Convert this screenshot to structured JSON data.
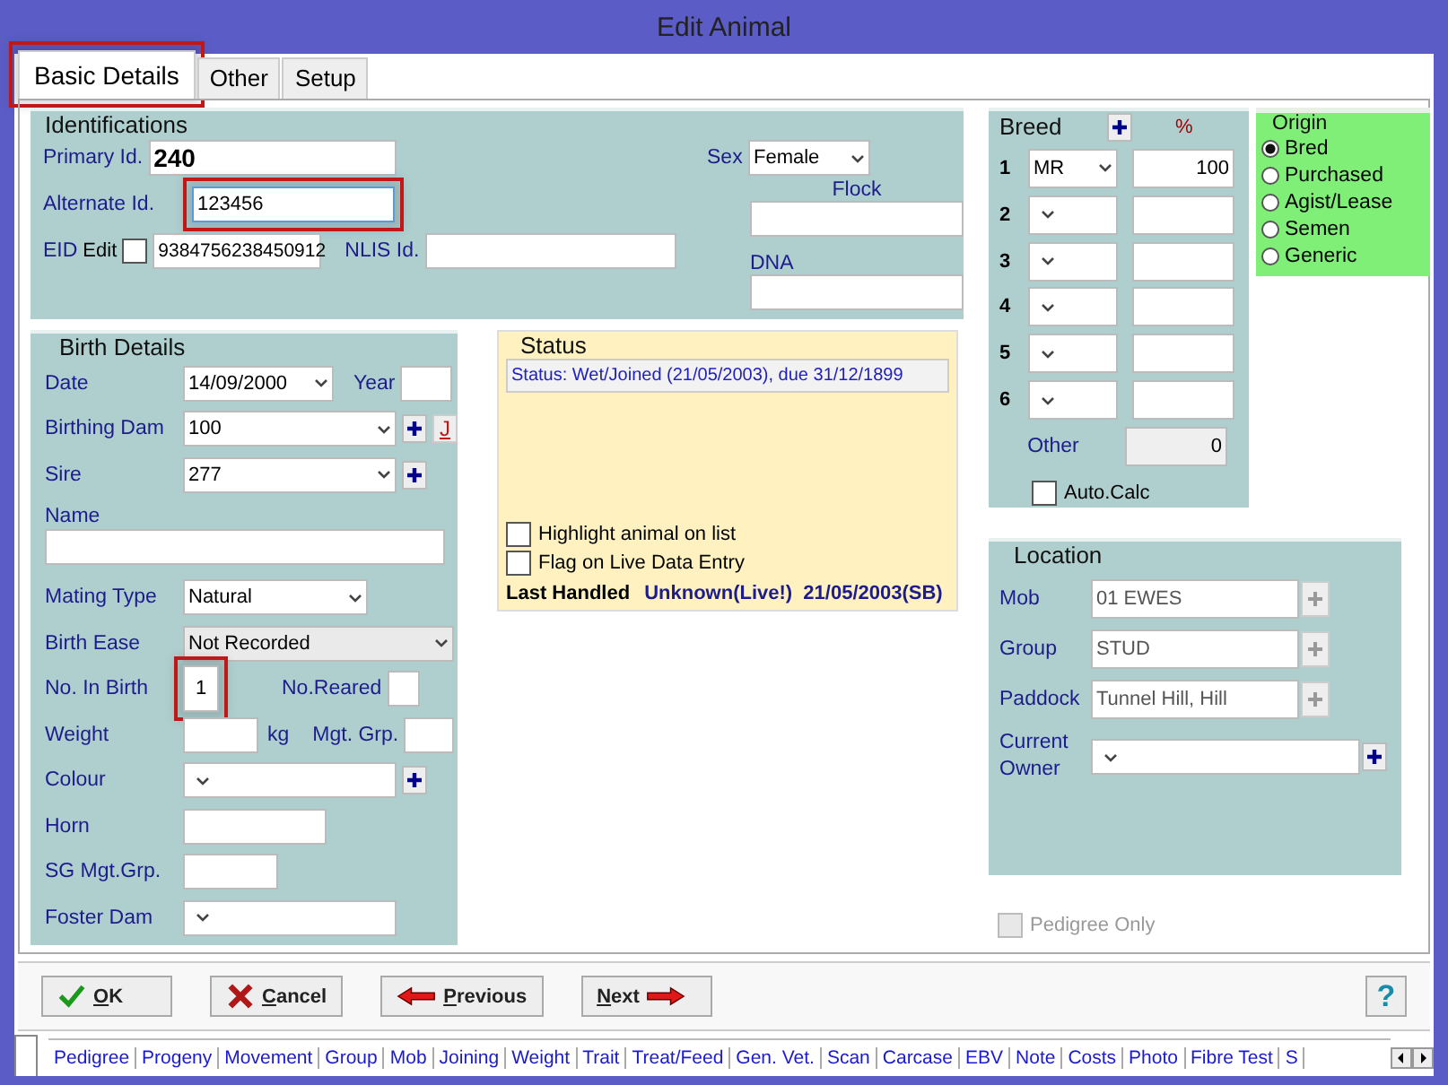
{
  "window": {
    "title": "Edit Animal"
  },
  "tabs": [
    {
      "label": "Basic Details",
      "selected": true,
      "highlighted": true
    },
    {
      "label": "Other",
      "selected": false,
      "highlighted": false
    },
    {
      "label": "Setup",
      "selected": false,
      "highlighted": false
    }
  ],
  "identifications": {
    "title": "Identifications",
    "primary_id": {
      "label": "Primary Id.",
      "value": "240"
    },
    "alternate_id": {
      "label": "Alternate Id.",
      "value": "123456",
      "highlighted": true
    },
    "eid": {
      "label": "EID",
      "edit_label": "Edit",
      "edit_checked": false,
      "value": "9384756238450912"
    },
    "nlis": {
      "label": "NLIS Id."
    },
    "sex": {
      "label": "Sex",
      "value": "Female"
    },
    "flock": {
      "label": "Flock"
    },
    "dna": {
      "label": "DNA"
    }
  },
  "birth_details": {
    "title": "Birth Details",
    "date": {
      "label": "Date",
      "value": "14/09/2000"
    },
    "year": {
      "label": "Year"
    },
    "birthing_dam": {
      "label": "Birthing Dam",
      "value": "100",
      "link": "J"
    },
    "sire": {
      "label": "Sire",
      "value": "277"
    },
    "name": {
      "label": "Name"
    },
    "mating_type": {
      "label": "Mating Type",
      "value": "Natural"
    },
    "birth_ease": {
      "label": "Birth Ease",
      "value": "Not Recorded"
    },
    "no_in_birth": {
      "label": "No. In Birth",
      "value": "1",
      "highlighted": true
    },
    "no_reared": {
      "label": "No.Reared"
    },
    "weight": {
      "label": "Weight",
      "unit": "kg"
    },
    "mgt_grp": {
      "label": "Mgt. Grp."
    },
    "colour": {
      "label": "Colour"
    },
    "horn": {
      "label": "Horn"
    },
    "sg_mgt_grp": {
      "label": "SG Mgt.Grp."
    },
    "foster_dam": {
      "label": "Foster Dam"
    }
  },
  "status": {
    "title": "Status",
    "text": "Status: Wet/Joined (21/05/2003), due 31/12/1899",
    "checkboxes": [
      {
        "label": "Highlight animal on list",
        "checked": false
      },
      {
        "label": "Flag on Live Data Entry",
        "checked": false
      }
    ],
    "last_handled": {
      "label": "Last Handled",
      "value": "Unknown(Live!)  21/05/2003(SB)"
    }
  },
  "breed": {
    "title": "Breed",
    "percent_header": "%",
    "rows": [
      {
        "number": "1",
        "breed": "MR",
        "percent": "100"
      },
      {
        "number": "2"
      },
      {
        "number": "3"
      },
      {
        "number": "4"
      },
      {
        "number": "5"
      },
      {
        "number": "6"
      }
    ],
    "other": {
      "label": "Other",
      "value": "0"
    },
    "auto_calc": {
      "label": "Auto.Calc",
      "checked": false
    }
  },
  "origin": {
    "title": "Origin",
    "options": [
      {
        "label": "Bred",
        "selected": true
      },
      {
        "label": "Purchased",
        "selected": false
      },
      {
        "label": "Agist/Lease",
        "selected": false
      },
      {
        "label": "Semen",
        "selected": false
      },
      {
        "label": "Generic",
        "selected": false
      }
    ]
  },
  "location": {
    "title": "Location",
    "rows": [
      {
        "label": "Mob",
        "value": "01 EWES"
      },
      {
        "label": "Group",
        "value": "STUD"
      },
      {
        "label": "Paddock",
        "value": "Tunnel Hill, Hill"
      }
    ],
    "current_owner": {
      "label": "Current Owner"
    }
  },
  "pedigree_only": {
    "label": "Pedigree Only",
    "checked": false,
    "disabled": true
  },
  "buttons": [
    {
      "label": "OK",
      "kind": "ok"
    },
    {
      "label": "Cancel",
      "kind": "cancel"
    },
    {
      "label": "Previous",
      "kind": "previous"
    },
    {
      "label": "Next",
      "kind": "next"
    }
  ],
  "help_button": {
    "label": "?"
  },
  "bottom_tabs": [
    "Pedigree",
    "Progeny",
    "Movement",
    "Group",
    "Mob",
    "Joining",
    "Weight",
    "Trait",
    "Treat/Feed",
    "Gen. Vet.",
    "Scan",
    "Carcase",
    "EBV",
    "Note",
    "Costs",
    "Photo",
    "Fibre Test",
    "S"
  ]
}
